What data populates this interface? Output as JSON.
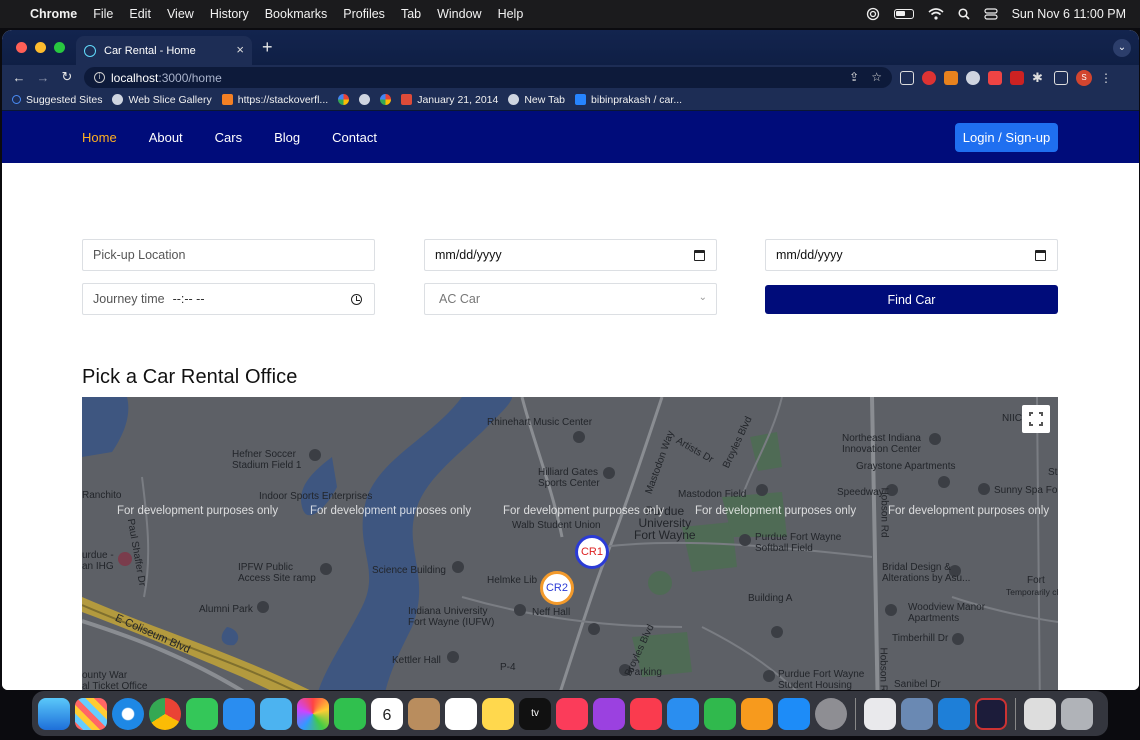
{
  "menubar": {
    "app_name": "Chrome",
    "items": [
      "File",
      "Edit",
      "View",
      "History",
      "Bookmarks",
      "Profiles",
      "Tab",
      "Window",
      "Help"
    ],
    "clock": "Sun Nov 6  11:00 PM"
  },
  "browser": {
    "tab_title": "Car Rental - Home",
    "url_host": "localhost",
    "url_path": ":3000/home",
    "profile_initial": "S",
    "bookmarks": [
      {
        "label": "Suggested Sites",
        "icon": "search-icon"
      },
      {
        "label": "Web Slice Gallery",
        "icon": "globe-icon"
      },
      {
        "label": "https://stackoverfl...",
        "icon": "stackoverflow-icon"
      },
      {
        "label": "",
        "icon": "google-icon"
      },
      {
        "label": "",
        "icon": "globe-icon"
      },
      {
        "label": "",
        "icon": "google-icon"
      },
      {
        "label": "January 21, 2014",
        "icon": "google-plus-icon"
      },
      {
        "label": "New Tab",
        "icon": "globe-icon"
      },
      {
        "label": "bibinprakash / car...",
        "icon": "bitbucket-icon"
      }
    ]
  },
  "site": {
    "nav": [
      "Home",
      "About",
      "Cars",
      "Blog",
      "Contact"
    ],
    "active_nav": "Home",
    "login_label": "Login / Sign-up",
    "accent": "#ffb020",
    "brand": "#000c7a"
  },
  "form": {
    "pickup_placeholder": "Pick-up Location",
    "date1": "mm/dd/yyyy",
    "date2": "mm/dd/yyyy",
    "journey_label": "Journey time",
    "journey_value": "--:-- --",
    "car_type": "AC Car",
    "find_label": "Find Car"
  },
  "section_title": "Pick a Car Rental Office",
  "map": {
    "watermark": "For development purposes only",
    "markers": [
      {
        "label": "CR1",
        "color": "#2b3bd6",
        "text_color": "#d22"
      },
      {
        "label": "CR2",
        "color": "#f39a2b",
        "text_color": "#2b3bd6"
      }
    ],
    "labels": {
      "rhinehart": "Rhinehart Music Center",
      "hefner": "Hefner Soccer\nStadium Field 1",
      "ranchito": "Ranchito",
      "indoor": "Indoor Sports Enterprises",
      "hilliard": "Hilliard Gates\nSports Center",
      "mastodon_field": "Mastodon Field",
      "purdue": "Purdue\nUniversity\nFort Wayne",
      "walb": "Walb Student Union",
      "northeast": "Northeast Indiana\nInnovation Center",
      "graystone": "Graystone Apartments",
      "speedway": "Speedway",
      "sunny": "Sunny Spa Fo",
      "purdue_softball": "Purdue Fort Wayne\nSoftball Field",
      "ipfw": "IPFW Public\nAccess Site ramp",
      "science": "Science Building",
      "helmke": "Helmke Lib",
      "neff": "Neff Hall",
      "bridal": "Bridal Design &\nAlterations by Asu...",
      "building_a": "Building A",
      "alumni": "Alumni Park",
      "indiana_univ": "Indiana University\nFort Wayne (IUFW)",
      "woodview": "Woodview Manor\nApartments",
      "kettler": "Kettler Hall",
      "timberhill": "Timberhill Dr",
      "parking": "Parking",
      "purdue_housing": "Purdue Fort Wayne\nStudent Housing",
      "coliseum": "E Coliseum Blvd",
      "county": "ounty War\nal Ticket Office",
      "hobson": "Hobson Rd",
      "sanibel": "Sanibel Dr",
      "p4": "P-4",
      "urdue_ihg": "urdue -\nan IHG",
      "niic": "NIIC",
      "fort": "Fort",
      "temporarily": "Temporarily cl",
      "artists": "Artists Dr",
      "mastodon_way": "Mastodon Way",
      "broyles": "Broyles Blvd",
      "paul": "Paul Shaffer Dr",
      "st": "St"
    }
  }
}
